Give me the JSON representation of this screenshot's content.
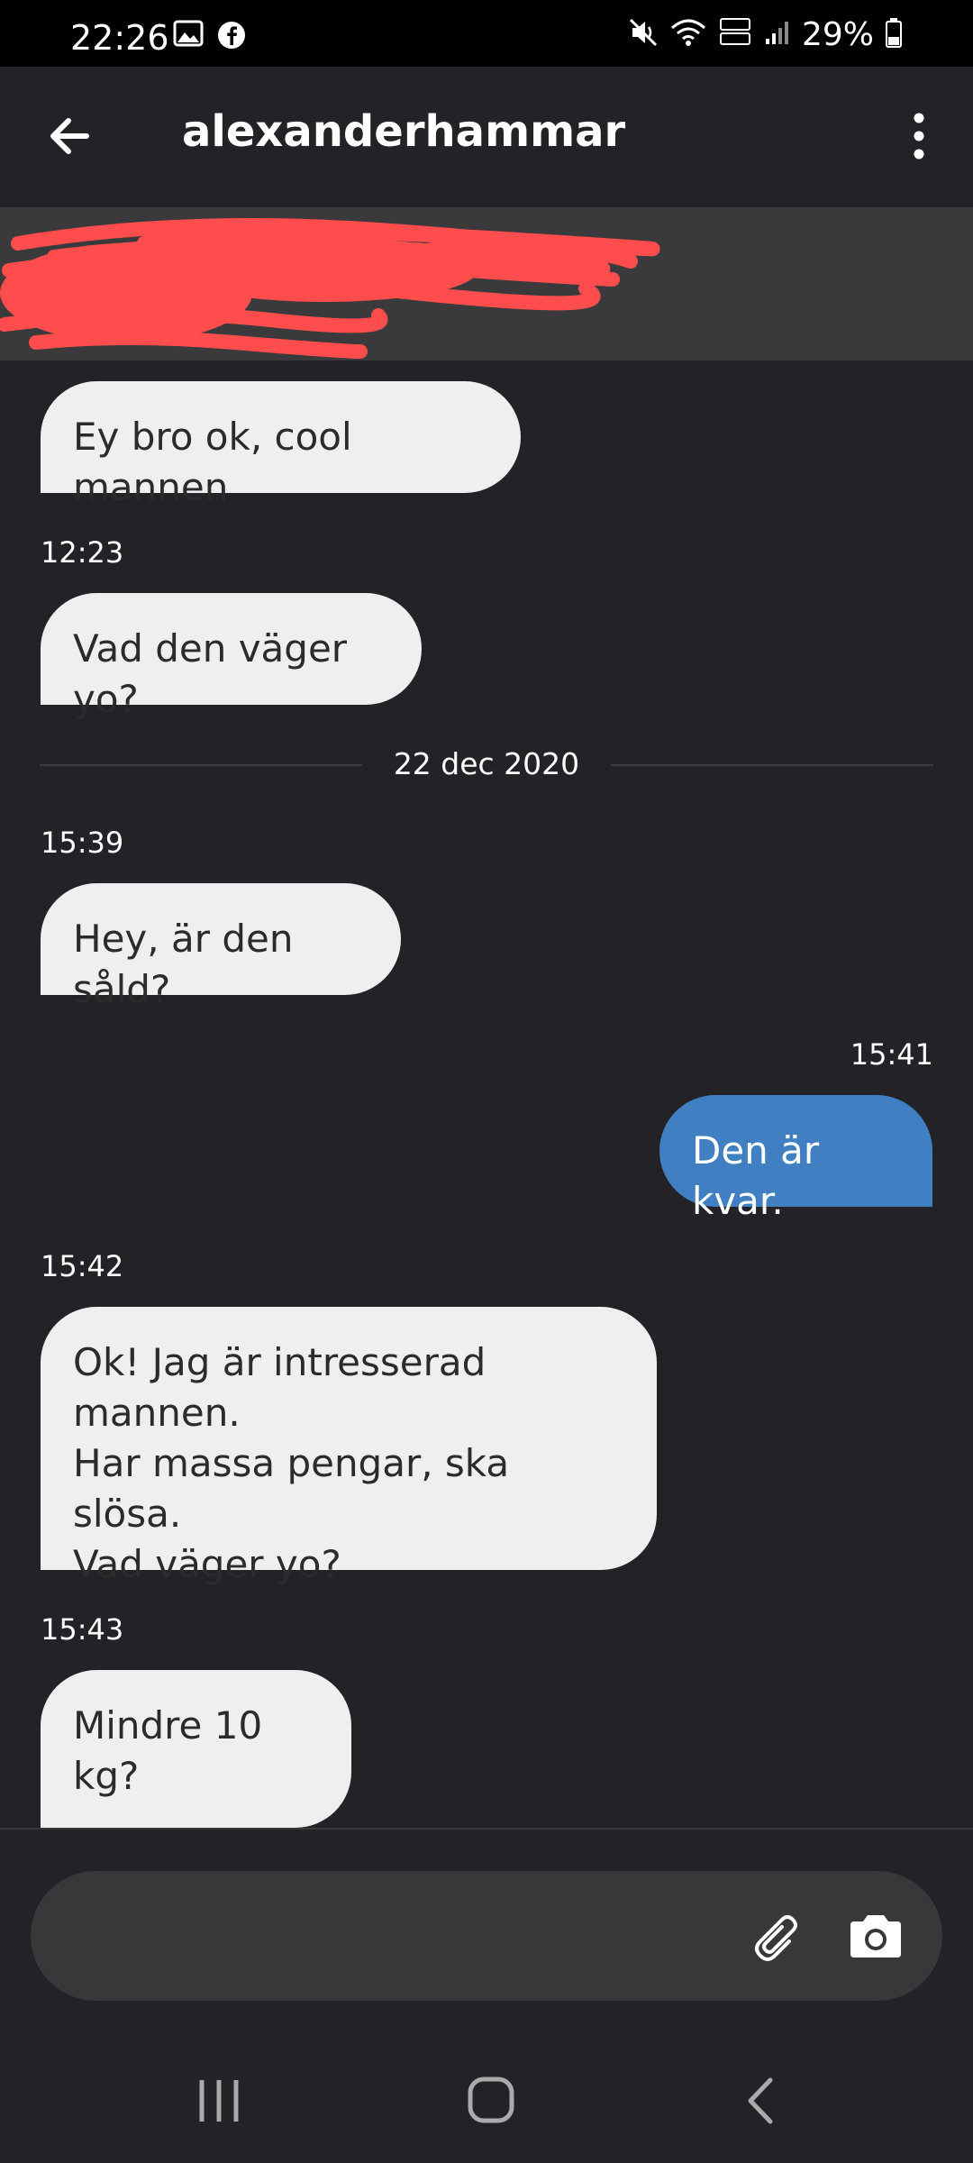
{
  "status_bar": {
    "time": "22:26",
    "battery": "29%"
  },
  "header": {
    "title": "alexanderhammar"
  },
  "messages": [
    {
      "text": "Ey bro ok, cool mannen"
    },
    {
      "time": "12:23",
      "text": "Vad den väger yo?"
    },
    {
      "date": "22 dec 2020"
    },
    {
      "time": "15:39",
      "text": "Hey, är den såld?"
    },
    {
      "time": "15:41",
      "text": "Den är kvar."
    },
    {
      "time": "15:42",
      "lines": [
        "Ok! Jag är intresserad mannen.",
        "Har massa pengar, ska slösa.",
        "Vad väger yo?"
      ]
    },
    {
      "time": "15:43",
      "text": "Mindre 10 kg?"
    }
  ],
  "composer": {
    "value": ""
  },
  "colors": {
    "background": "#232327",
    "incoming_bubble": "#efefef",
    "outgoing_bubble": "#3f7fc2",
    "redaction": "#ff4d4d"
  }
}
